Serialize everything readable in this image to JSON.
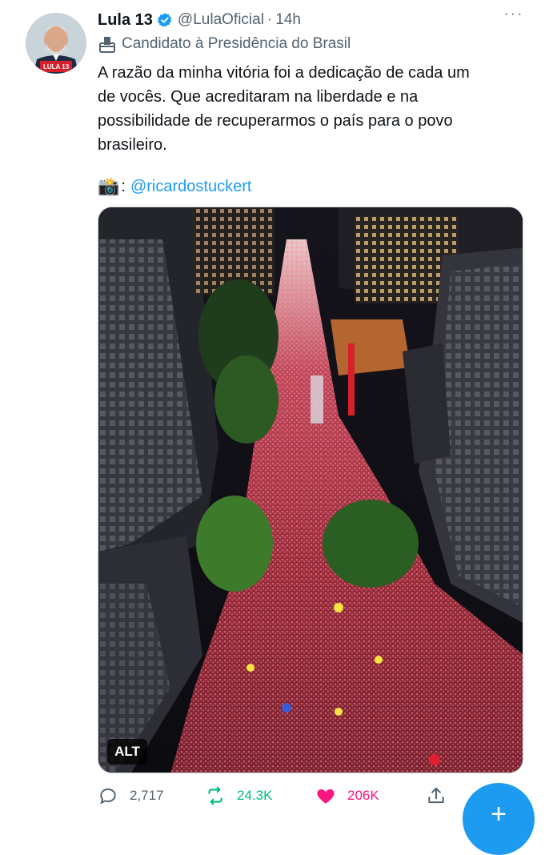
{
  "tweet": {
    "author_name": "Lula 13",
    "handle": "@LulaOficial",
    "separator": "·",
    "time": "14h",
    "more_glyph": "···",
    "label": "Candidato à Presidência do Brasil",
    "text_lines": [
      "A razão da minha vitória foi a dedicação de cada um",
      "de vocês. Que acreditaram na liberdade e na",
      "possibilidade de recuperarmos o país para o povo",
      "brasileiro."
    ],
    "credit_emoji": "📸",
    "credit_colon": ":",
    "mention": "@ricardostuckert",
    "alt_badge": "ALT",
    "avatar_badge": "LULA 13"
  },
  "actions": {
    "replies": "2,717",
    "retweets": "24.3K",
    "likes": "206K"
  },
  "fab_glyph": "+",
  "colors": {
    "accent": "#1d9bf0",
    "retweet": "#00ba7c",
    "like": "#f91880",
    "secondary_text": "#536471"
  },
  "icons": [
    "verified-badge-icon",
    "ballot-box-icon",
    "camera-icon",
    "reply-icon",
    "retweet-icon",
    "heart-icon",
    "share-icon",
    "more-icon",
    "compose-icon"
  ]
}
